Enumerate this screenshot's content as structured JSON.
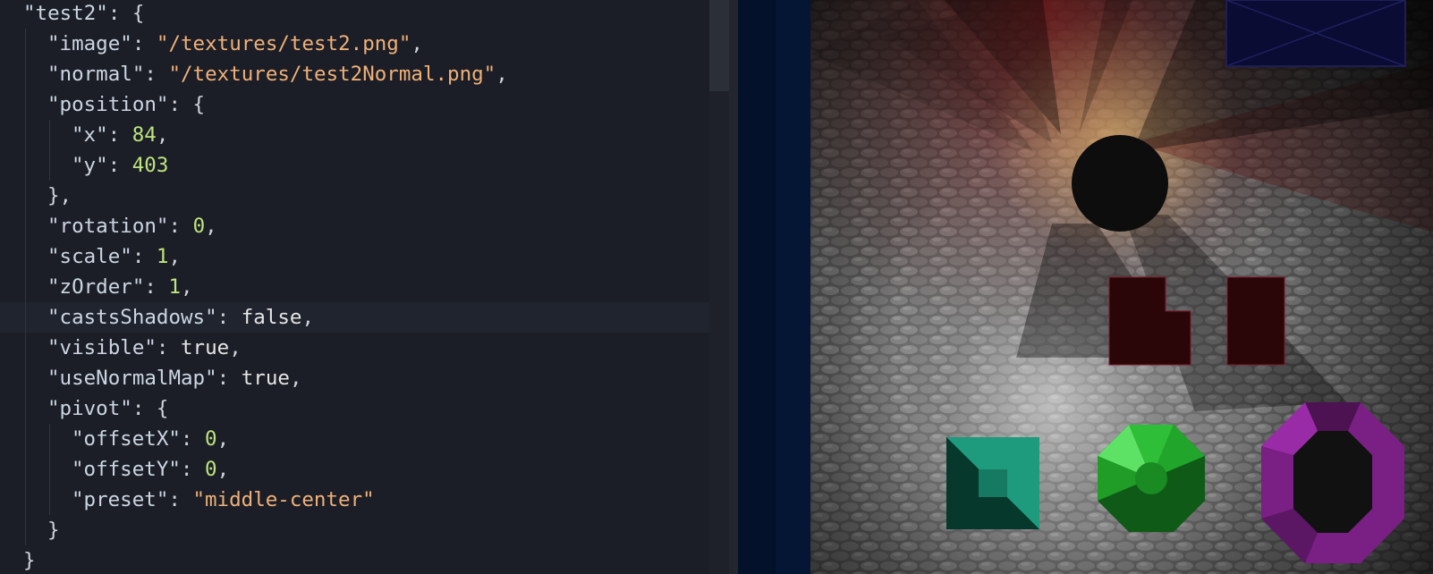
{
  "editor": {
    "lines": [
      {
        "indent": 0,
        "tokens": [
          {
            "t": "k",
            "v": "\"test2\""
          },
          {
            "t": "p",
            "v": ": {"
          }
        ]
      },
      {
        "indent": 1,
        "tokens": [
          {
            "t": "k",
            "v": "\"image\""
          },
          {
            "t": "p",
            "v": ": "
          },
          {
            "t": "s",
            "v": "\"/textures/test2.png\""
          },
          {
            "t": "p",
            "v": ","
          }
        ]
      },
      {
        "indent": 1,
        "tokens": [
          {
            "t": "k",
            "v": "\"normal\""
          },
          {
            "t": "p",
            "v": ": "
          },
          {
            "t": "s",
            "v": "\"/textures/test2Normal.png\""
          },
          {
            "t": "p",
            "v": ","
          }
        ]
      },
      {
        "indent": 1,
        "tokens": [
          {
            "t": "k",
            "v": "\"position\""
          },
          {
            "t": "p",
            "v": ": {"
          }
        ]
      },
      {
        "indent": 2,
        "tokens": [
          {
            "t": "k",
            "v": "\"x\""
          },
          {
            "t": "p",
            "v": ": "
          },
          {
            "t": "n",
            "v": "84"
          },
          {
            "t": "p",
            "v": ","
          }
        ]
      },
      {
        "indent": 2,
        "tokens": [
          {
            "t": "k",
            "v": "\"y\""
          },
          {
            "t": "p",
            "v": ": "
          },
          {
            "t": "n",
            "v": "403"
          }
        ]
      },
      {
        "indent": 1,
        "tokens": [
          {
            "t": "p",
            "v": "},"
          }
        ]
      },
      {
        "indent": 1,
        "tokens": [
          {
            "t": "k",
            "v": "\"rotation\""
          },
          {
            "t": "p",
            "v": ": "
          },
          {
            "t": "n",
            "v": "0"
          },
          {
            "t": "p",
            "v": ","
          }
        ]
      },
      {
        "indent": 1,
        "tokens": [
          {
            "t": "k",
            "v": "\"scale\""
          },
          {
            "t": "p",
            "v": ": "
          },
          {
            "t": "n",
            "v": "1"
          },
          {
            "t": "p",
            "v": ","
          }
        ]
      },
      {
        "indent": 1,
        "tokens": [
          {
            "t": "k",
            "v": "\"zOrder\""
          },
          {
            "t": "p",
            "v": ": "
          },
          {
            "t": "n",
            "v": "1"
          },
          {
            "t": "p",
            "v": ","
          }
        ]
      },
      {
        "indent": 1,
        "active": true,
        "tokens": [
          {
            "t": "k",
            "v": "\"castsShadows\""
          },
          {
            "t": "p",
            "v": ": "
          },
          {
            "t": "b",
            "v": "false"
          },
          {
            "t": "p",
            "v": ","
          }
        ]
      },
      {
        "indent": 1,
        "tokens": [
          {
            "t": "k",
            "v": "\"visible\""
          },
          {
            "t": "p",
            "v": ": "
          },
          {
            "t": "b",
            "v": "true"
          },
          {
            "t": "p",
            "v": ","
          }
        ]
      },
      {
        "indent": 1,
        "tokens": [
          {
            "t": "k",
            "v": "\"useNormalMap\""
          },
          {
            "t": "p",
            "v": ": "
          },
          {
            "t": "b",
            "v": "true"
          },
          {
            "t": "p",
            "v": ","
          }
        ]
      },
      {
        "indent": 1,
        "tokens": [
          {
            "t": "k",
            "v": "\"pivot\""
          },
          {
            "t": "p",
            "v": ": {"
          }
        ]
      },
      {
        "indent": 2,
        "tokens": [
          {
            "t": "k",
            "v": "\"offsetX\""
          },
          {
            "t": "p",
            "v": ": "
          },
          {
            "t": "n",
            "v": "0"
          },
          {
            "t": "p",
            "v": ","
          }
        ]
      },
      {
        "indent": 2,
        "tokens": [
          {
            "t": "k",
            "v": "\"offsetY\""
          },
          {
            "t": "p",
            "v": ": "
          },
          {
            "t": "n",
            "v": "0"
          },
          {
            "t": "p",
            "v": ","
          }
        ]
      },
      {
        "indent": 2,
        "tokens": [
          {
            "t": "k",
            "v": "\"preset\""
          },
          {
            "t": "p",
            "v": ": "
          },
          {
            "t": "s",
            "v": "\"middle-center\""
          }
        ]
      },
      {
        "indent": 1,
        "tokens": [
          {
            "t": "p",
            "v": "}"
          }
        ]
      },
      {
        "indent": 0,
        "tokens": [
          {
            "t": "p",
            "v": "}"
          }
        ]
      }
    ]
  },
  "colors": {
    "editor_background": "#1b1e26",
    "active_line": "#20242e",
    "key": "#ccd6e3",
    "string": "#f0b07a",
    "number": "#bde47e",
    "keyword": "#e6e6e6"
  },
  "scene": {
    "description_icons": [
      "wall-texture",
      "red-light",
      "yellow-light",
      "white-light",
      "dark-ball-object",
      "dark-red-block-object",
      "teal-square-gem",
      "green-octagon-gem",
      "purple-octagon-ring"
    ]
  }
}
